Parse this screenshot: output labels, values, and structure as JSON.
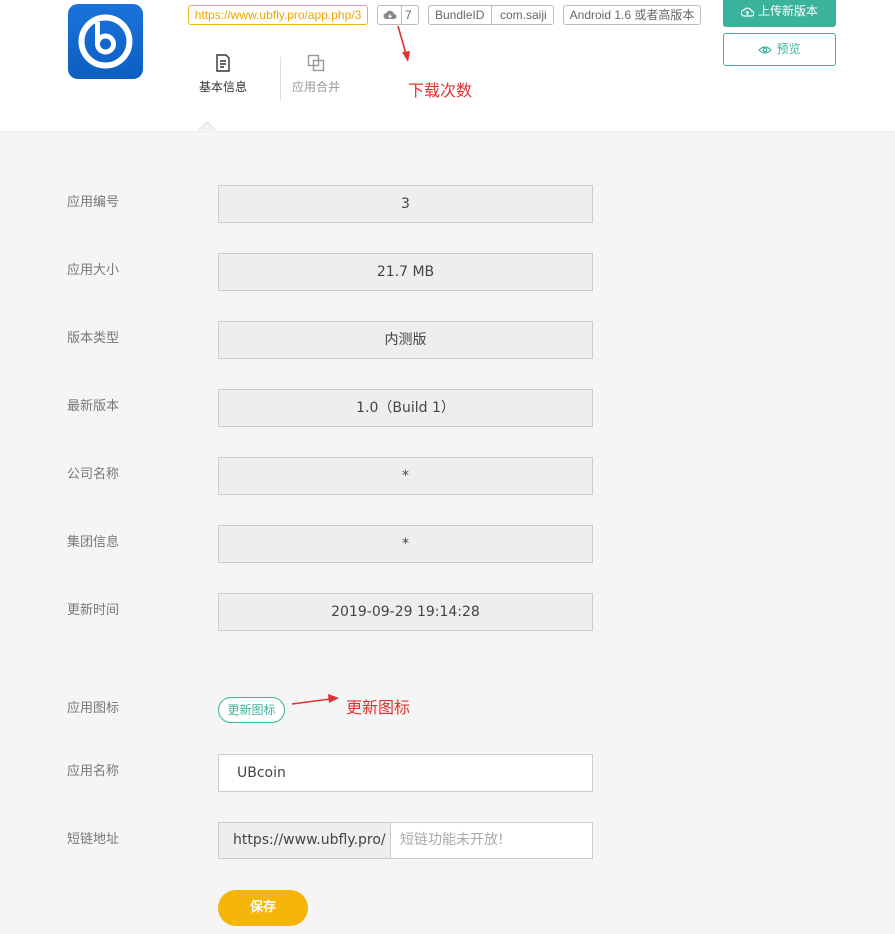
{
  "header": {
    "app_url": "https://www.ubfly.pro/app.php/3",
    "download_count": "7",
    "bundle_id_label": "BundleID",
    "bundle_id_value": "com.saiji",
    "platform": "Android 1.6 或者高版本",
    "upload_button": "上传新版本",
    "preview_button": "预览",
    "accent_color": "#3bb39c",
    "logo_color": "#1468cf"
  },
  "tabs": [
    {
      "label": "基本信息",
      "icon": "document-icon",
      "active": true
    },
    {
      "label": "应用合并",
      "icon": "copy-icon",
      "active": false
    }
  ],
  "annotations": {
    "download_note": "下载次数",
    "icon_note": "更新图标",
    "color": "#e23030"
  },
  "info": {
    "app_id_label": "应用编号",
    "app_id": "3",
    "size_label": "应用大小",
    "size": "21.7 MB",
    "type_label": "版本类型",
    "type": "内测版",
    "latest_label": "最新版本",
    "latest": "1.0（Build 1）",
    "company_label": "公司名称",
    "company": "*",
    "group_label": "集团信息",
    "group": "*",
    "updated_label": "更新时间",
    "updated": "2019-09-29 19:14:28"
  },
  "form": {
    "icon_label": "应用图标",
    "update_icon_button": "更新图标",
    "name_label": "应用名称",
    "name_value": "UBcoin",
    "short_link_label": "短链地址",
    "short_link_prefix": "https://www.ubfly.pro/",
    "short_link_placeholder": "短链功能未开放!",
    "save_button": "保存",
    "save_color": "#f5b50a"
  }
}
